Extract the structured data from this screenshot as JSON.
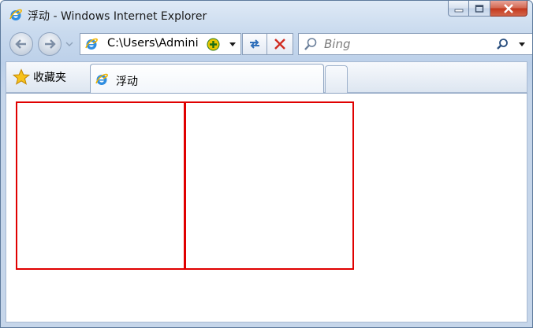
{
  "window": {
    "title": "浮动 - Windows Internet Explorer"
  },
  "navigation": {
    "address": "C:\\Users\\Admini",
    "search_placeholder": "Bing"
  },
  "tabs": {
    "favorites_label": "收藏夹",
    "active_tab_label": "浮动"
  },
  "content": {
    "boxes": [
      {
        "border_color": "#e00000"
      },
      {
        "border_color": "#e00000"
      }
    ]
  },
  "icons": {
    "window_icon": "ie-icon",
    "favorites_icon": "star-icon",
    "search_icon": "magnifier-icon"
  }
}
